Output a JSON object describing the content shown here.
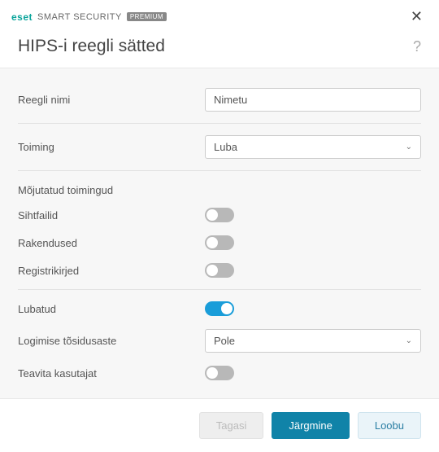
{
  "brand": {
    "logo_text": "eset",
    "product_name": "SMART SECURITY",
    "badge": "PREMIUM"
  },
  "header": {
    "title": "HIPS-i reegli sätted"
  },
  "fields": {
    "rule_name": {
      "label": "Reegli nimi",
      "value": "Nimetu"
    },
    "action": {
      "label": "Toiming",
      "selected": "Luba"
    }
  },
  "section": {
    "affected_ops": "Mõjutatud toimingud"
  },
  "toggles": {
    "target_files": {
      "label": "Sihtfailid",
      "on": false
    },
    "applications": {
      "label": "Rakendused",
      "on": false
    },
    "registry": {
      "label": "Registrikirjed",
      "on": false
    },
    "enabled": {
      "label": "Lubatud",
      "on": true
    },
    "notify_user": {
      "label": "Teavita kasutajat",
      "on": false
    }
  },
  "logging": {
    "label": "Logimise tõsidusaste",
    "selected": "Pole"
  },
  "footer": {
    "back": "Tagasi",
    "next": "Järgmine",
    "cancel": "Loobu"
  }
}
